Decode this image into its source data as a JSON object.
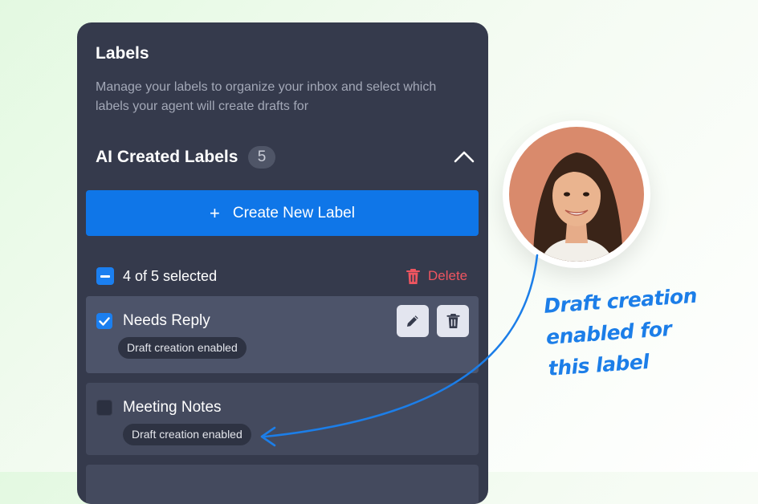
{
  "panel": {
    "title": "Labels",
    "description": "Manage your labels to organize your inbox and select which labels your agent will create drafts for"
  },
  "section": {
    "title": "AI Created Labels",
    "count": "5",
    "collapse_icon": "chevron-up-icon"
  },
  "create_button": {
    "icon": "plus-icon",
    "plus_glyph": "+",
    "label": "Create New Label"
  },
  "selection": {
    "text": "4 of 5 selected",
    "delete_label": "Delete",
    "delete_icon": "trash-icon"
  },
  "labels": [
    {
      "name": "Needs Reply",
      "badge": "Draft creation enabled",
      "checked": true,
      "actions": [
        "pencil-icon",
        "trash-icon"
      ]
    },
    {
      "name": "Meeting Notes",
      "badge": "Draft creation enabled",
      "checked": false
    }
  ],
  "annotation": {
    "line1": "Draft creation",
    "line2": "enabled for",
    "line3": "this label"
  },
  "colors": {
    "panel_bg": "#353a4c",
    "accent_blue": "#0f76e8",
    "delete_red": "#ef5560",
    "annotation_blue": "#1c7ee8"
  }
}
